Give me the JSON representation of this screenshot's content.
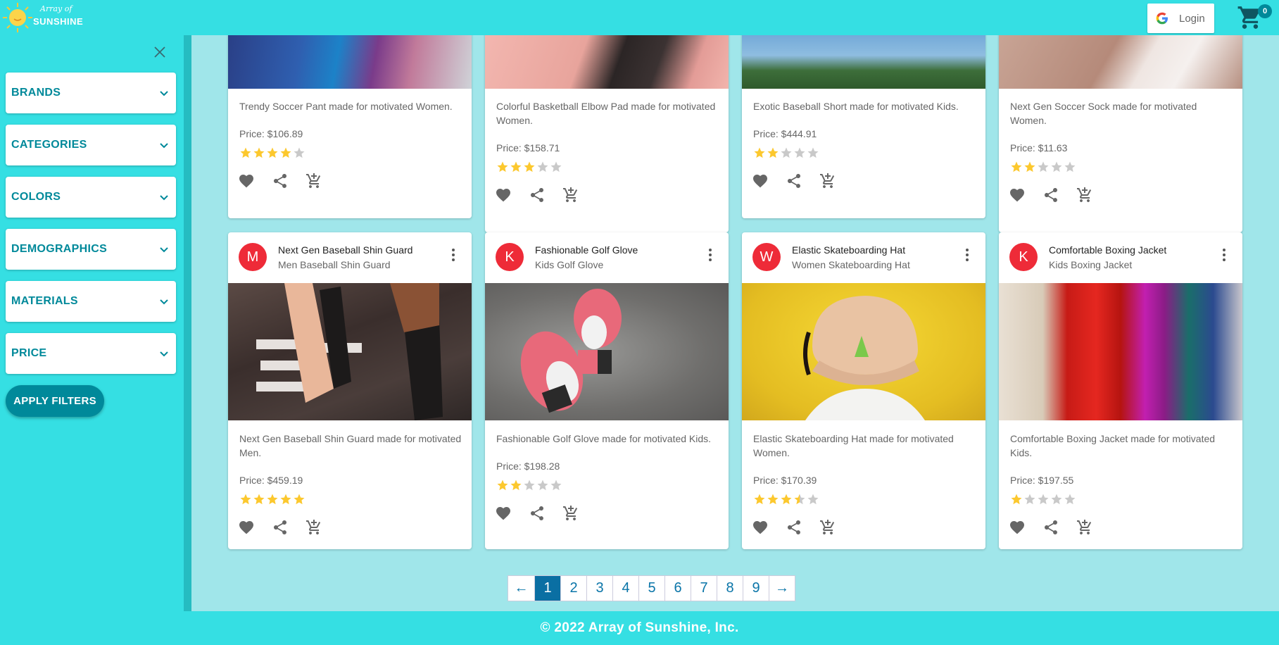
{
  "brand": {
    "line1": "Array of",
    "line2": "SUNSHINE"
  },
  "header": {
    "login_label": "Login",
    "cart_count": "0"
  },
  "filters": {
    "items": [
      "BRANDS",
      "CATEGORIES",
      "COLORS",
      "DEMOGRAPHICS",
      "MATERIALS",
      "PRICE"
    ],
    "apply_label": "APPLY FILTERS"
  },
  "products_top": [
    {
      "description": "Trendy Soccer Pant made for motivated Women.",
      "price": "Price: $106.89",
      "rating": 4
    },
    {
      "description": "Colorful Basketball Elbow Pad made for motivated Women.",
      "price": "Price: $158.71",
      "rating": 3
    },
    {
      "description": "Exotic Baseball Short made for motivated Kids.",
      "price": "Price: $444.91",
      "rating": 2
    },
    {
      "description": "Next Gen Soccer Sock made for motivated Women.",
      "price": "Price: $11.63",
      "rating": 2
    }
  ],
  "products": [
    {
      "avatar": "M",
      "title": "Next Gen Baseball Shin Guard",
      "subtitle": "Men Baseball Shin Guard",
      "description": "Next Gen Baseball Shin Guard made for motivated Men.",
      "price": "Price: $459.19",
      "rating": 5
    },
    {
      "avatar": "K",
      "title": "Fashionable Golf Glove",
      "subtitle": "Kids Golf Glove",
      "description": "Fashionable Golf Glove made for motivated Kids.",
      "price": "Price: $198.28",
      "rating": 2
    },
    {
      "avatar": "W",
      "title": "Elastic Skateboarding Hat",
      "subtitle": "Women Skateboarding Hat",
      "description": "Elastic Skateboarding Hat made for motivated Women.",
      "price": "Price: $170.39",
      "rating": 3.5
    },
    {
      "avatar": "K",
      "title": "Comfortable Boxing Jacket",
      "subtitle": "Kids Boxing Jacket",
      "description": "Comfortable Boxing Jacket made for motivated Kids.",
      "price": "Price: $197.55",
      "rating": 1
    }
  ],
  "pagination": {
    "prev": "←",
    "pages": [
      "1",
      "2",
      "3",
      "4",
      "5",
      "6",
      "7",
      "8",
      "9"
    ],
    "next": "→",
    "current": "1"
  },
  "footer": {
    "text": "© 2022 Array of Sunshine, Inc."
  },
  "colors": {
    "accent": "#35dfe3",
    "brand_teal": "#00899a",
    "avatar_red": "#ee2b38",
    "star": "#fcc82e"
  }
}
